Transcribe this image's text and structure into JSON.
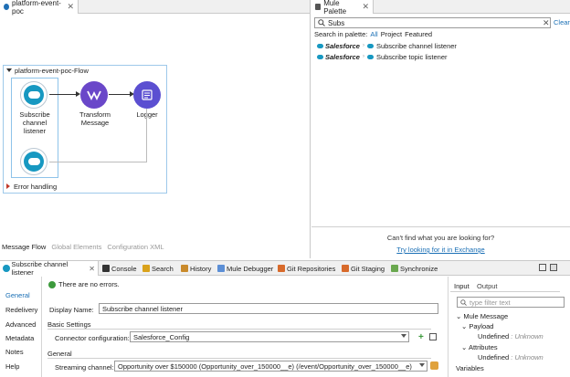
{
  "editor": {
    "tab_title": "platform-event-poc",
    "tab_close": "✕",
    "flow_name": "platform-event-poc-Flow",
    "nodes": [
      {
        "label_lines": [
          "Subscribe",
          "channel",
          "listener"
        ]
      },
      {
        "label_lines": [
          "Transform",
          "Message"
        ]
      },
      {
        "label_lines": [
          "Logger"
        ]
      }
    ],
    "error_handling": "Error handling",
    "bottom_tabs": [
      "Message Flow",
      "Global Elements",
      "Configuration XML"
    ]
  },
  "palette": {
    "tab_title": "Mule Palette",
    "tab_close": "✕",
    "search_value": "Subs",
    "clear_x": "✕",
    "clear_label": "Clear",
    "search_in_label": "Search in palette:",
    "scopes": [
      "All",
      "Project",
      "Featured"
    ],
    "results": [
      {
        "module": "Salesforce",
        "label": "Subscribe channel listener"
      },
      {
        "module": "Salesforce",
        "label": "Subscribe topic listener"
      }
    ],
    "cant_find": "Can't find what you are looking for?",
    "exchange_link": "Try looking for it in Exchange"
  },
  "props": {
    "tabs": [
      "Subscribe channel listener",
      "Console",
      "Search",
      "History",
      "Mule Debugger",
      "Git Repositories",
      "Git Staging",
      "Synchronize"
    ],
    "tab_close": "✕",
    "nav": [
      "General",
      "Redelivery",
      "Advanced",
      "Metadata",
      "Notes",
      "Help"
    ],
    "status": "There are no errors.",
    "display_name_label": "Display Name:",
    "display_name_value": "Subscribe channel listener",
    "basic_settings": "Basic Settings",
    "connector_config_label": "Connector configuration:",
    "connector_config_value": "Salesforce_Config",
    "general_section": "General",
    "streaming_channel_label": "Streaming channel:",
    "streaming_channel_value": "Opportunity over $150000 (Opportunity_over_150000__e) (/event/Opportunity_over_150000__e)"
  },
  "io": {
    "tabs": [
      "Input",
      "Output"
    ],
    "filter_placeholder": "type filter text",
    "tree": {
      "mule_message": "Mule Message",
      "payload": "Payload",
      "payload_value": "Undefined",
      "payload_type": ": Unknown",
      "attributes": "Attributes",
      "attributes_value": "Undefined",
      "attributes_type": ": Unknown",
      "variables": "Variables"
    }
  }
}
